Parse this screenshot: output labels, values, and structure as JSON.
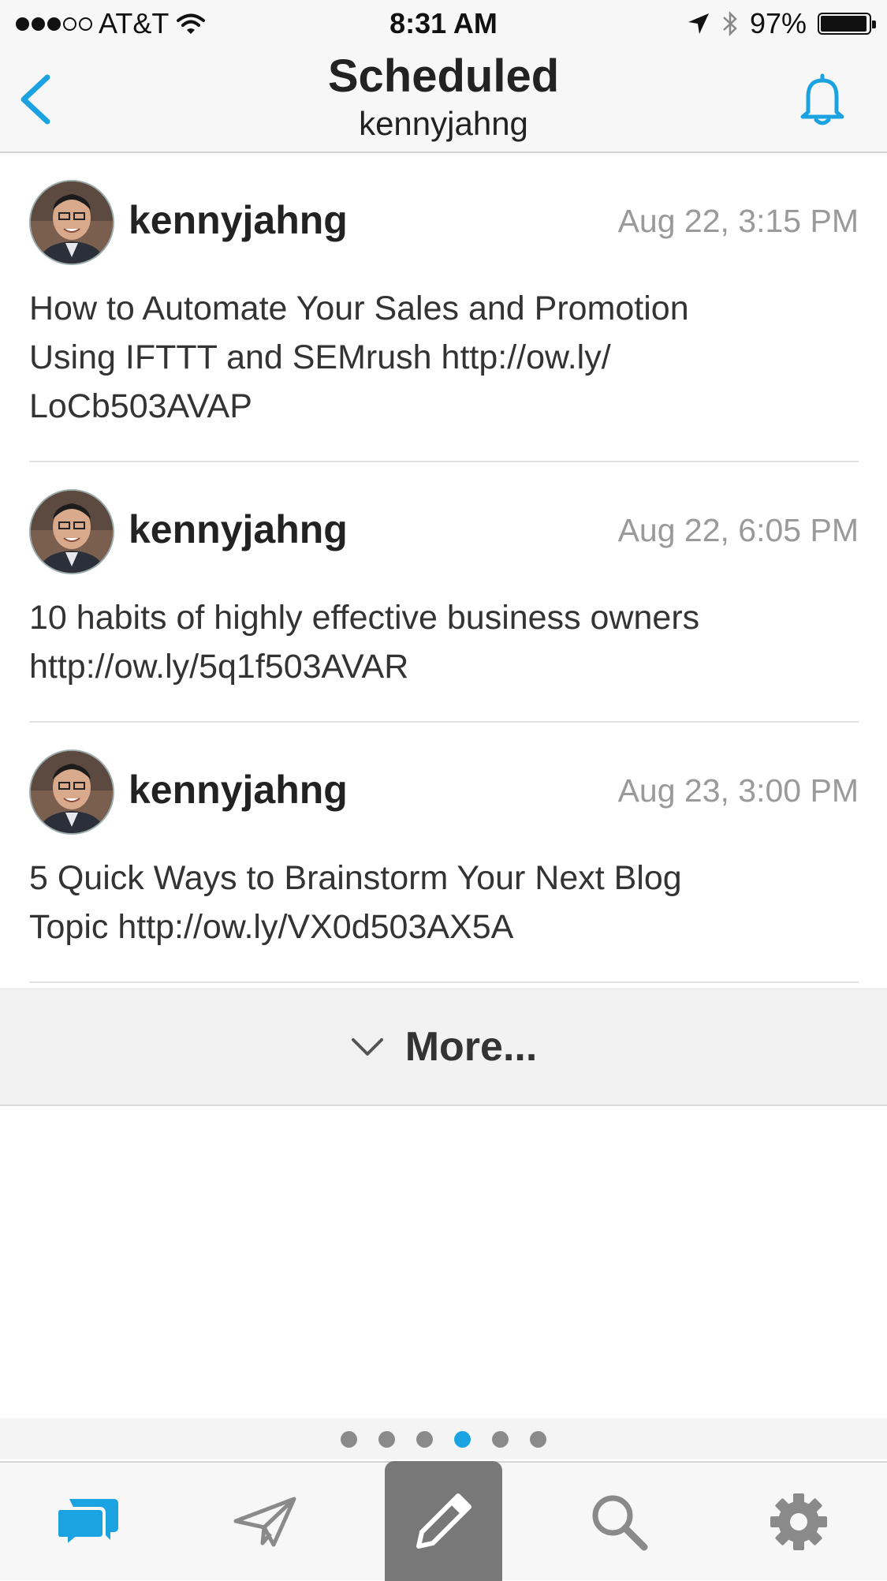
{
  "status_bar": {
    "carrier": "AT&T",
    "time": "8:31 AM",
    "battery": "97%",
    "battery_level": 0.97
  },
  "nav": {
    "title": "Scheduled",
    "subtitle": "kennyjahng",
    "back_icon": "chevron-left-icon",
    "right_icon": "bell-icon"
  },
  "posts": [
    {
      "user": "kennyjahng",
      "time": "Aug 22, 3:15 PM",
      "text": "How to Automate Your Sales and Promotion\nUsing IFTTT and SEMrush http://ow.ly/\nLoCb503AVAP"
    },
    {
      "user": "kennyjahng",
      "time": "Aug 22, 6:05 PM",
      "text": "10 habits of highly effective business owners\nhttp://ow.ly/5q1f503AVAR"
    },
    {
      "user": "kennyjahng",
      "time": "Aug 23, 3:00 PM",
      "text": "5 Quick Ways to Brainstorm Your Next Blog\nTopic http://ow.ly/VX0d503AX5A"
    }
  ],
  "more": {
    "label": "More..."
  },
  "page_indicator": {
    "count": 6,
    "active_index": 3
  },
  "tabs": [
    {
      "icon": "chat-bubbles-icon",
      "active": true
    },
    {
      "icon": "paper-plane-icon",
      "active": false
    },
    {
      "icon": "pencil-icon",
      "active": false
    },
    {
      "icon": "search-icon",
      "active": false
    },
    {
      "icon": "gear-icon",
      "active": false
    }
  ],
  "colors": {
    "accent": "#1aa3e0",
    "compose_bg": "#787878",
    "inactive_icon": "#8a8a8a"
  }
}
